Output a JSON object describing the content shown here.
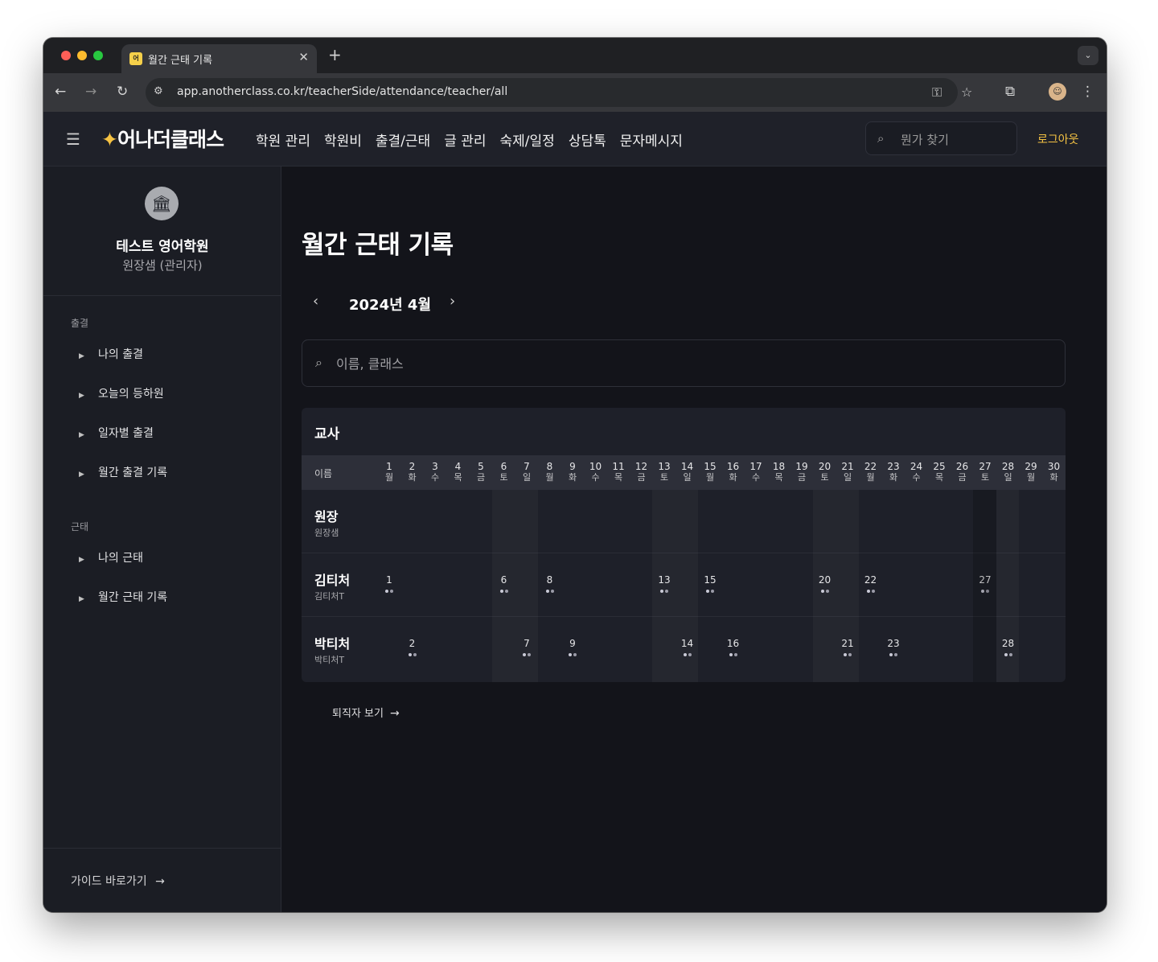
{
  "browser": {
    "tab_title": "월간 근태 기록",
    "favicon_text": "어",
    "url": "app.anotherclass.co.kr/teacherSide/attendance/teacher/all"
  },
  "header": {
    "logo": "어나더클래스",
    "nav": [
      "학원 관리",
      "학원비",
      "출결/근태",
      "글 관리",
      "숙제/일정",
      "상담톡",
      "문자메시지"
    ],
    "search_placeholder": "뭔가 찾기",
    "logout": "로그아웃"
  },
  "sidebar": {
    "academy_name": "테스트 영어학원",
    "user_role": "원장샘 (관리자)",
    "sections": [
      {
        "title": "출결",
        "items": [
          "나의 출결",
          "오늘의 등하원",
          "일자별 출결",
          "월간 출결 기록"
        ]
      },
      {
        "title": "근태",
        "items": [
          "나의 근태",
          "월간 근태 기록"
        ]
      }
    ],
    "guide_link": "가이드 바로가기"
  },
  "main": {
    "title": "월간 근태 기록",
    "month_label": "2024년 4월",
    "search_placeholder": "이름, 클래스",
    "table": {
      "section_title": "교사",
      "name_header": "이름",
      "days": [
        "1",
        "2",
        "3",
        "4",
        "5",
        "6",
        "7",
        "8",
        "9",
        "10",
        "11",
        "12",
        "13",
        "14",
        "15",
        "16",
        "17",
        "18",
        "19",
        "20",
        "21",
        "22",
        "23",
        "24",
        "25",
        "26",
        "27",
        "28",
        "29",
        "30"
      ],
      "weekdays": [
        "월",
        "화",
        "수",
        "목",
        "금",
        "토",
        "일",
        "월",
        "화",
        "수",
        "목",
        "금",
        "토",
        "일",
        "월",
        "화",
        "수",
        "목",
        "금",
        "토",
        "일",
        "월",
        "화",
        "수",
        "목",
        "금",
        "토",
        "일",
        "월",
        "화"
      ],
      "rows": [
        {
          "name": "원장",
          "sub": "원장샘",
          "entries": []
        },
        {
          "name": "김티처",
          "sub": "김티처T",
          "entries": [
            "1",
            "6",
            "8",
            "13",
            "15",
            "20",
            "22",
            "27"
          ]
        },
        {
          "name": "박티처",
          "sub": "박티처T",
          "entries": [
            "2",
            "7",
            "9",
            "14",
            "16",
            "21",
            "23",
            "28"
          ]
        }
      ]
    },
    "retired_link": "퇴직자 보기"
  },
  "colors": {
    "accent": "#f5c343",
    "background": "#13141a",
    "sidebar": "#1b1d24",
    "card": "#1e2029"
  }
}
